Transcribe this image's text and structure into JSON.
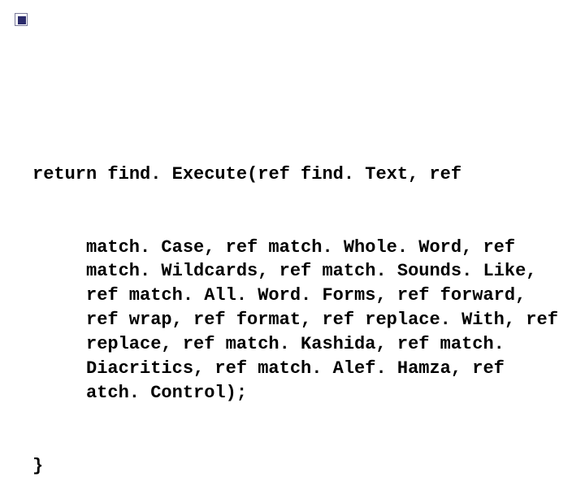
{
  "code": {
    "line0": "return find. Execute(ref find. Text, ref",
    "indented": "match. Case, ref match. Whole. Word, ref match. Wildcards, ref match. Sounds. Like, ref match. All. Word. Forms, ref forward, ref wrap, ref format, ref replace. With, ref replace, ref match. Kashida, ref match. Diacritics, ref match. Alef. Hamza, ref atch. Control);",
    "close": "}"
  }
}
